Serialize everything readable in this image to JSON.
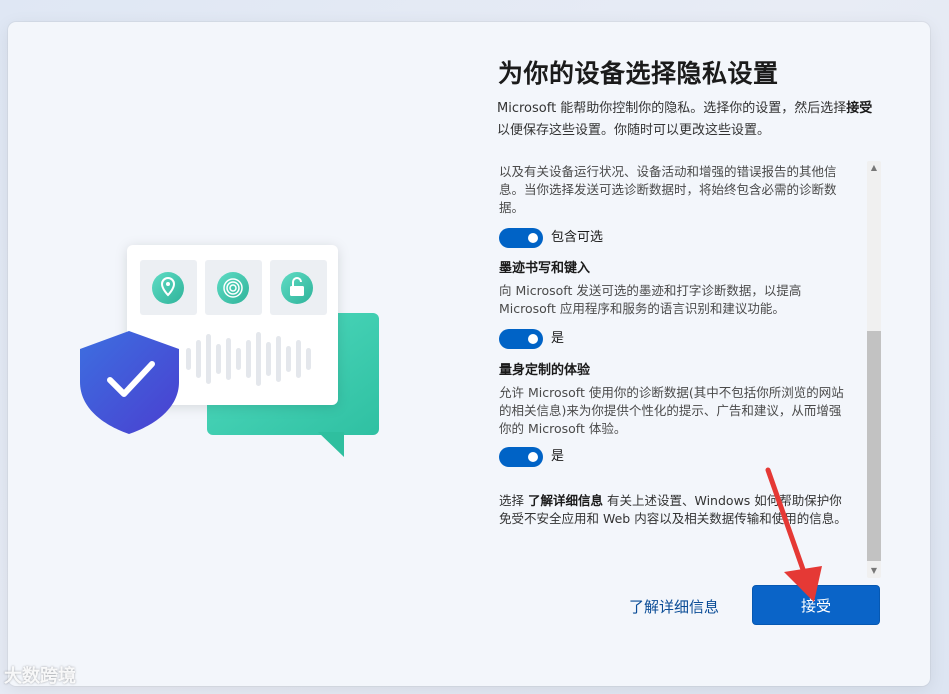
{
  "page": {
    "title": "为你的设备选择隐私设置",
    "intro_text_1": "Microsoft 能帮助你控制你的隐私。选择你的设置，然后选择",
    "intro_bold": "接受",
    "intro_text_2": "以便保存这些设置。你随时可以更改这些设置。"
  },
  "settings": {
    "partial_desc": "以及有关设备运行状况、设备活动和增强的错误报告的其他信息。当你选择发送可选诊断数据时，将始终包含必需的诊断数据。",
    "items": [
      {
        "heading": "",
        "toggle_label": "包含可选",
        "enabled": true
      },
      {
        "heading": "墨迹书写和键入",
        "desc": "向 Microsoft 发送可选的墨迹和打字诊断数据，以提高 Microsoft 应用程序和服务的语言识别和建议功能。",
        "toggle_label": "是",
        "enabled": true
      },
      {
        "heading": "量身定制的体验",
        "desc": "允许 Microsoft 使用你的诊断数据(其中不包括你所浏览的网站的相关信息)来为你提供个性化的提示、广告和建议，从而增强你的 Microsoft 体验。",
        "toggle_label": "是",
        "enabled": true
      }
    ],
    "footer_text_1": "选择",
    "footer_bold": "了解详细信息",
    "footer_text_2": "有关上述设置、Windows 如何帮助保护你免受不安全应用和 Web 内容以及相关数据传输和使用的信息。"
  },
  "actions": {
    "learn_more_label": "了解详细信息",
    "accept_label": "接受"
  },
  "icons": {
    "illustration_icons": [
      "location-icon",
      "fingerprint-icon",
      "lock-icon",
      "shield-check-icon",
      "speech-bubble-icon"
    ]
  },
  "colors": {
    "accent": "#0a64c8",
    "teal": "#3fcfb0",
    "shield": "#3a5fd9",
    "annotation_arrow": "#e53935"
  },
  "watermark": "大数跨境"
}
